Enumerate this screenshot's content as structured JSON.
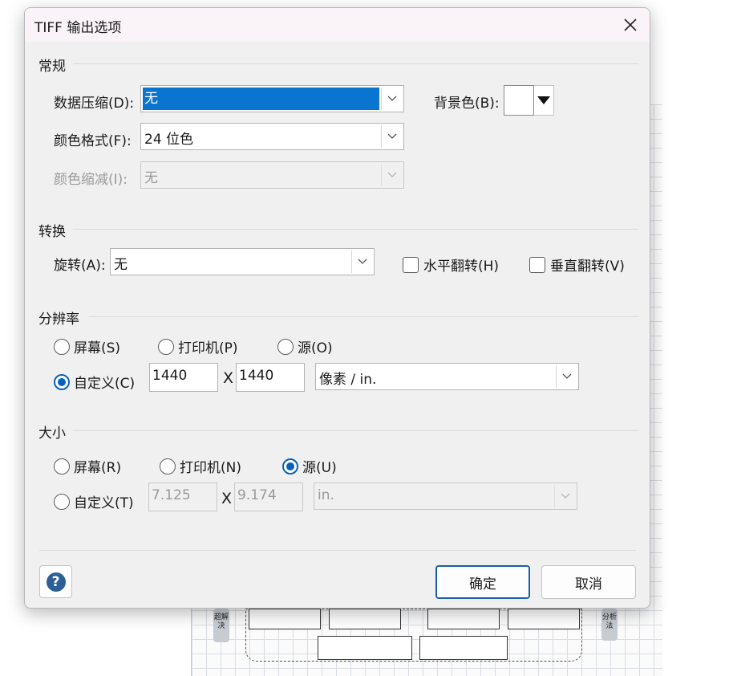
{
  "dialog": {
    "title": "TIFF 输出选项",
    "close_icon": "close-icon"
  },
  "general": {
    "section": "常规",
    "compression_label": "数据压缩(D):",
    "compression_value": "无",
    "color_format_label": "颜色格式(F):",
    "color_format_value": "24 位色",
    "color_reduction_label": "颜色缩减(I):",
    "color_reduction_value": "无",
    "background_label": "背景色(B):",
    "background_color": "#ffffff"
  },
  "transform": {
    "section": "转换",
    "rotation_label": "旋转(A):",
    "rotation_value": "无",
    "flip_h_label": "水平翻转(H)",
    "flip_h_checked": false,
    "flip_v_label": "垂直翻转(V)",
    "flip_v_checked": false
  },
  "resolution": {
    "section": "分辨率",
    "screen_label": "屏幕(S)",
    "printer_label": "打印机(P)",
    "source_label": "源(O)",
    "custom_label": "自定义(C)",
    "selected": "custom",
    "width_value": "1440",
    "x_sep": "X",
    "height_value": "1440",
    "unit_value": "像素 / in."
  },
  "size": {
    "section": "大小",
    "screen_label": "屏幕(R)",
    "printer_label": "打印机(N)",
    "source_label": "源(U)",
    "custom_label": "自定义(T)",
    "selected": "source",
    "width_value": "7.125",
    "x_sep": "X",
    "height_value": "9.174",
    "unit_value": "in."
  },
  "footer": {
    "help_symbol": "?",
    "ok_label": "确定",
    "cancel_label": "取消"
  },
  "background_diagram": {
    "left_tag": "超解决",
    "right_tag": "分析法"
  },
  "colors": {
    "accent": "#0a62b8",
    "selection": "#0a74d1",
    "dialog_bg": "#f0f0f0"
  }
}
